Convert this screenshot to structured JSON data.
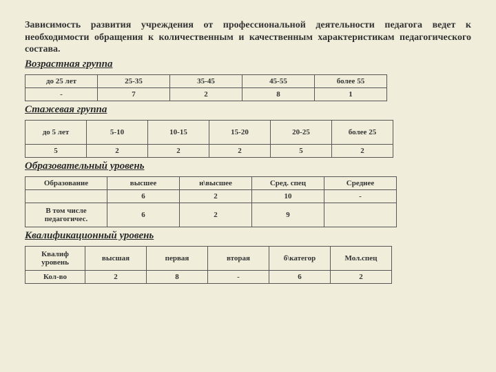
{
  "intro": "Зависимость развития учреждения от профессиональной деятельности педагога ведет к необходимости обращения к количественным и качественным характеристикам педагогического состава.",
  "sections": {
    "age": {
      "title": "Возрастная группа",
      "headers": [
        "до 25 лет",
        "25-35",
        "35-45",
        "45-55",
        "более 55"
      ],
      "values": [
        "-",
        "7",
        "2",
        "8",
        "1"
      ]
    },
    "experience": {
      "title": "Стажевая группа",
      "headers": [
        "до 5 лет",
        "5-10",
        "10-15",
        "15-20",
        "20-25",
        "более 25"
      ],
      "values": [
        "5",
        "2",
        "2",
        "2",
        "5",
        "2"
      ]
    },
    "education": {
      "title": "Образовательный уровень",
      "col0": "Образование",
      "headers": [
        "высшее",
        "н\\высшее",
        "Сред. спец",
        "Среднее"
      ],
      "row1_label": "",
      "row1": [
        "6",
        "2",
        "10",
        "-"
      ],
      "row2_label": "В том числе педагогичес.",
      "row2": [
        "6",
        "2",
        "9",
        ""
      ]
    },
    "qualification": {
      "title": "Квалификационный уровень",
      "col0": "Квалиф уровень",
      "headers": [
        "высшая",
        "первая",
        "вторая",
        "б\\категор",
        "Мол.спец"
      ],
      "row_label": "Кол-во",
      "values": [
        "2",
        "8",
        "-",
        "6",
        "2"
      ]
    }
  }
}
